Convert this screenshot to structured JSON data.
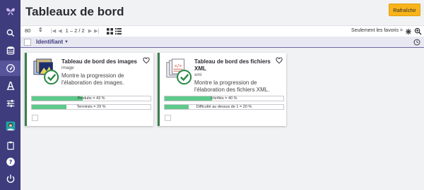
{
  "header": {
    "title": "Tableaux de bord",
    "refresh_label": "Rafraîchir"
  },
  "toolbar": {
    "per_page": "80",
    "page_text": "1 – 2 / 2",
    "favorites_label": "Seulement les favoris ="
  },
  "sort": {
    "label": "Identifiant"
  },
  "sidebar": {
    "items": [
      {
        "icon": "search-icon"
      },
      {
        "icon": "database-icon"
      },
      {
        "icon": "dashboard-gauge-icon",
        "active": true
      },
      {
        "icon": "font-icon"
      },
      {
        "icon": "sliders-icon"
      },
      {
        "icon": "user-avatar-icon"
      },
      {
        "icon": "clipboard-icon"
      },
      {
        "icon": "help-icon"
      },
      {
        "icon": "power-icon"
      }
    ]
  },
  "cards": [
    {
      "title": "Tableau de bord des images",
      "format": "image",
      "description": "Montre la progression de l'élaboration des images.",
      "bars": [
        {
          "label": "Produits = 43 %",
          "value": 0.43
        },
        {
          "label": "Terminés = 29 %",
          "value": 0.29
        }
      ]
    },
    {
      "title": "Tableau de bord des fichiers XML",
      "format": "xml",
      "description": "Montre la progression de l'élaboration des fichiers XML.",
      "bars": [
        {
          "label": "Vérifiés = 40 %",
          "value": 0.4
        },
        {
          "label": "Difficulté au dessus de 1 = 20 %",
          "value": 0.2
        }
      ]
    }
  ],
  "colors": {
    "sidebar": "#3e3c7d",
    "accent_button": "#f8b41a",
    "progress_fill": "#5ec98a",
    "card_border": "#3c7d4f"
  }
}
